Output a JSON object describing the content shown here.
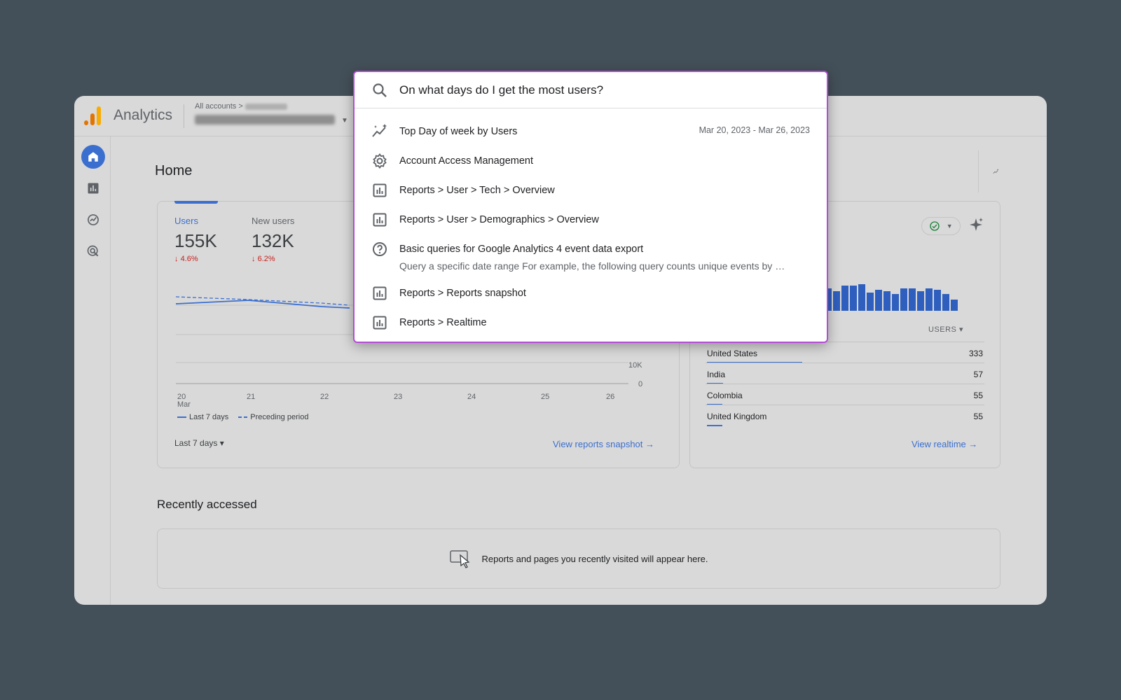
{
  "app": {
    "name": "Analytics"
  },
  "breadcrumb": {
    "all_accounts": "All accounts",
    "separator": ">"
  },
  "page": {
    "title": "Home"
  },
  "metrics": [
    {
      "label": "Users",
      "value": "155K",
      "delta": "4.6%"
    },
    {
      "label": "New users",
      "value": "132K",
      "delta": "6.2%"
    }
  ],
  "chart": {
    "x_ticks": [
      "20",
      "21",
      "22",
      "23",
      "24",
      "25",
      "26"
    ],
    "x_month": "Mar",
    "y_ticks": [
      "10K",
      "0"
    ],
    "legend": {
      "current": "Last 7 days",
      "previous": "Preceding period"
    }
  },
  "date_range": {
    "label": "Last 7 days"
  },
  "links": {
    "reports_snapshot": "View reports snapshot",
    "realtime": "View realtime"
  },
  "realtime": {
    "column_header": "USERS",
    "rows": [
      {
        "country": "United States",
        "users": "333",
        "share": 1.0
      },
      {
        "country": "India",
        "users": "57",
        "share": 0.17
      },
      {
        "country": "Colombia",
        "users": "55",
        "share": 0.165
      },
      {
        "country": "United Kingdom",
        "users": "55",
        "share": 0.165
      }
    ]
  },
  "recent": {
    "title": "Recently accessed",
    "empty_message": "Reports and pages you recently visited will appear here."
  },
  "search": {
    "query": "On what days do I get the most users?",
    "results": [
      {
        "icon": "insights-icon",
        "title": "Top Day of week by Users",
        "date": "Mar 20, 2023 - Mar 26, 2023"
      },
      {
        "icon": "gear-icon",
        "title": "Account Access Management"
      },
      {
        "icon": "report-icon",
        "title": "Reports > User > Tech > Overview"
      },
      {
        "icon": "report-icon",
        "title": "Reports > User > Demographics > Overview"
      },
      {
        "icon": "help-icon",
        "title": "Basic queries for Google Analytics 4 event data export",
        "snippet": "Query a specific date range For example, the following query counts unique events by …"
      },
      {
        "icon": "report-icon",
        "title": "Reports > Reports snapshot"
      },
      {
        "icon": "report-icon",
        "title": "Reports > Realtime"
      }
    ]
  },
  "colors": {
    "accent": "#3b6fcf",
    "highlight_border": "#b54bd6",
    "negative": "#c5221f",
    "backdrop": "#445059"
  }
}
